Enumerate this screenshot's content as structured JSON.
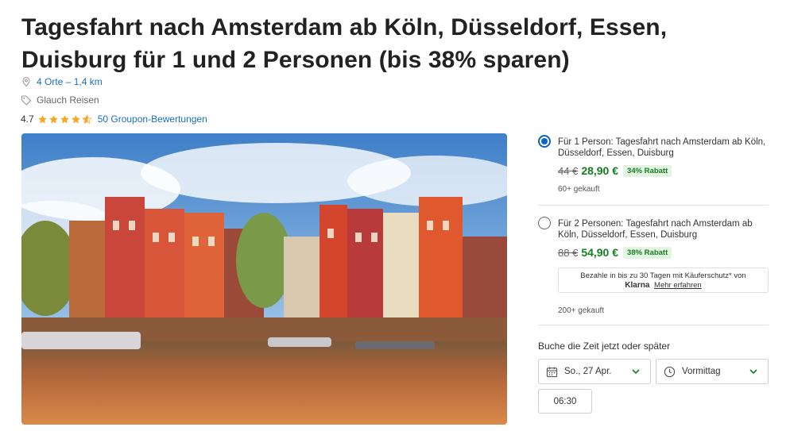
{
  "deal": {
    "title": "Tagesfahrt nach Amsterdam ab Köln, Düsseldorf, Essen, Duisburg für 1 und 2 Personen (bis 38% sparen)",
    "locations": "4 Orte – 1,4 km",
    "merchant": "Glauch Reisen",
    "rating": "4.7",
    "rating_value": 4.7,
    "rating_max": 5,
    "reviews": "50 Groupon-Bewertungen",
    "accent_color": "#1a6fc1",
    "price_color": "#137e20"
  },
  "options": [
    {
      "title": "Für 1 Person: Tagesfahrt nach Amsterdam ab Köln, Düsseldorf, Essen, Duisburg",
      "old_price": "44 €",
      "new_price": "28,90 €",
      "discount": "34% Rabatt",
      "sold": "60+ gekauft",
      "selected": true
    },
    {
      "title": "Für 2 Personen: Tagesfahrt nach Amsterdam ab Köln, Düsseldorf, Essen, Duisburg",
      "old_price": "88 €",
      "new_price": "54,90 €",
      "discount": "38% Rabatt",
      "sold": "200+ gekauft",
      "selected": false
    }
  ],
  "klarna": {
    "text": "Bezahle in bis zu 30 Tagen mit Käuferschutz* von",
    "logo": "Klarna",
    "link": "Mehr erfahren"
  },
  "booking": {
    "label": "Buche die Zeit jetzt oder später",
    "date": "So., 27 Apr.",
    "period": "Vormittag",
    "time_slot": "06:30"
  },
  "icons": {
    "location": "map-pin-icon",
    "merchant": "tag-icon",
    "date": "calendar-icon",
    "time": "clock-icon"
  }
}
